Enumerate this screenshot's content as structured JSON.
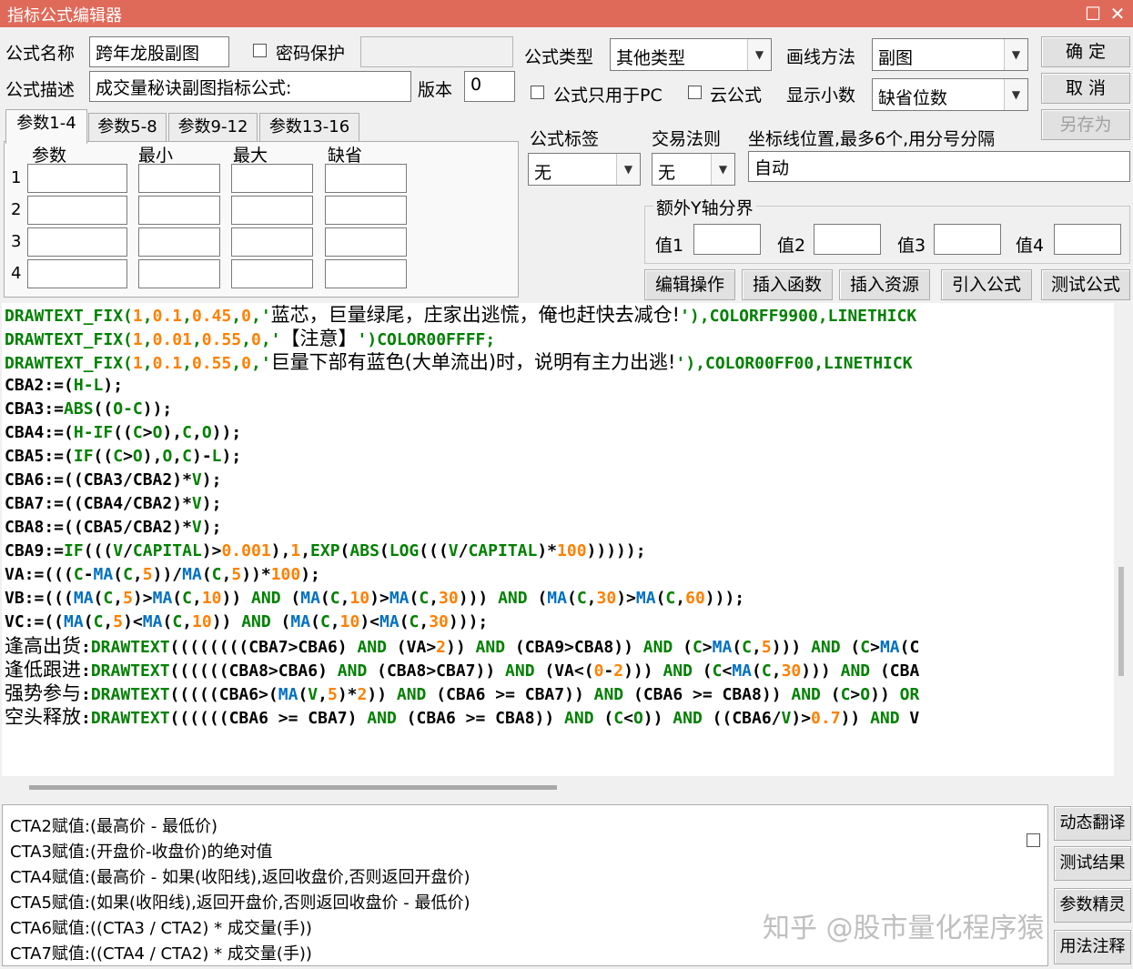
{
  "window": {
    "title": "指标公式编辑器"
  },
  "form": {
    "name_label": "公式名称",
    "name_value": "跨年龙股副图",
    "password_label": "密码保护",
    "desc_label": "公式描述",
    "desc_value": "成交量秘诀副图指标公式:",
    "version_label": "版本",
    "version_value": "0",
    "type_label": "公式类型",
    "type_value": "其他类型",
    "draw_label": "画线方法",
    "draw_value": "副图",
    "pc_only_label": "公式只用于PC",
    "cloud_label": "云公式",
    "decimal_label": "显示小数",
    "decimal_value": "缺省位数",
    "tag_label": "公式标签",
    "tag_value": "无",
    "rule_label": "交易法则",
    "rule_value": "无",
    "coord_label": "坐标线位置,最多6个,用分号分隔",
    "coord_value": "自动",
    "yaxis_label": "额外Y轴分界",
    "v1": "值1",
    "v2": "值2",
    "v3": "值3",
    "v4": "值4"
  },
  "buttons": {
    "ok": "确 定",
    "cancel": "取 消",
    "saveas": "另存为",
    "edit": "编辑操作",
    "insert_func": "插入函数",
    "insert_res": "插入资源",
    "import": "引入公式",
    "test": "测试公式",
    "translate": "动态翻译",
    "result": "测试结果",
    "wizard": "参数精灵",
    "usage": "用法注释"
  },
  "tabs": [
    "参数1-4",
    "参数5-8",
    "参数9-12",
    "参数13-16"
  ],
  "params": {
    "headers": [
      "参数",
      "最小",
      "最大",
      "缺省"
    ],
    "rows": [
      "1",
      "2",
      "3",
      "4"
    ]
  },
  "code_lines": [
    [
      [
        "DRAWTEXT_FIX(",
        "g"
      ],
      [
        "1",
        "o"
      ],
      [
        ",",
        "g"
      ],
      [
        "0.1",
        "o"
      ],
      [
        ",",
        "g"
      ],
      [
        "0.45",
        "o"
      ],
      [
        ",",
        "g"
      ],
      [
        "0",
        "o"
      ],
      [
        ",'",
        "g"
      ],
      [
        "蓝芯，巨量绿尾，庄家出逃慌，俺也赶快去减仓!",
        "zh"
      ],
      [
        "'),COLORFF9900,LINETHICK",
        "g"
      ]
    ],
    [
      [
        "DRAWTEXT_FIX(",
        "g"
      ],
      [
        "1",
        "o"
      ],
      [
        ",",
        "g"
      ],
      [
        "0.01",
        "o"
      ],
      [
        ",",
        "g"
      ],
      [
        "0.55",
        "o"
      ],
      [
        ",",
        "g"
      ],
      [
        "0",
        "o"
      ],
      [
        ",'",
        "g"
      ],
      [
        "【注意】",
        "zh"
      ],
      [
        "')COLOR00FFFF;",
        "g"
      ]
    ],
    [
      [
        "DRAWTEXT_FIX(",
        "g"
      ],
      [
        "1",
        "o"
      ],
      [
        ",",
        "g"
      ],
      [
        "0.1",
        "o"
      ],
      [
        ",",
        "g"
      ],
      [
        "0.55",
        "o"
      ],
      [
        ",",
        "g"
      ],
      [
        "0",
        "o"
      ],
      [
        ",'",
        "g"
      ],
      [
        "巨量下部有蓝色(大单流出)时，说明有主力出逃!",
        "zh"
      ],
      [
        "'),COLOR00FF00,LINETHICK",
        "g"
      ]
    ],
    [
      [
        "CBA2:=(",
        "b"
      ],
      [
        "H-L",
        "g"
      ],
      [
        ");",
        "b"
      ]
    ],
    [
      [
        "CBA3:=",
        "b"
      ],
      [
        "ABS",
        "g"
      ],
      [
        "((",
        "b"
      ],
      [
        "O-C",
        "g"
      ],
      [
        "));",
        "b"
      ]
    ],
    [
      [
        "CBA4:=(",
        "b"
      ],
      [
        "H-IF",
        "g"
      ],
      [
        "((",
        "b"
      ],
      [
        "C",
        "g"
      ],
      [
        ">",
        "b"
      ],
      [
        "O",
        "g"
      ],
      [
        "),",
        "b"
      ],
      [
        "C",
        "g"
      ],
      [
        ",",
        "b"
      ],
      [
        "O",
        "g"
      ],
      [
        "));",
        "b"
      ]
    ],
    [
      [
        "CBA5:=(",
        "b"
      ],
      [
        "IF",
        "g"
      ],
      [
        "((",
        "b"
      ],
      [
        "C",
        "g"
      ],
      [
        ">",
        "b"
      ],
      [
        "O",
        "g"
      ],
      [
        "),",
        "b"
      ],
      [
        "O",
        "g"
      ],
      [
        ",",
        "b"
      ],
      [
        "C",
        "g"
      ],
      [
        ")-",
        "b"
      ],
      [
        "L",
        "g"
      ],
      [
        ");",
        "b"
      ]
    ],
    [
      [
        "CBA6:=((CBA3/CBA2)*",
        "b"
      ],
      [
        "V",
        "g"
      ],
      [
        ");",
        "b"
      ]
    ],
    [
      [
        "CBA7:=((CBA4/CBA2)*",
        "b"
      ],
      [
        "V",
        "g"
      ],
      [
        ");",
        "b"
      ]
    ],
    [
      [
        "CBA8:=((CBA5/CBA2)*",
        "b"
      ],
      [
        "V",
        "g"
      ],
      [
        ");",
        "b"
      ]
    ],
    [
      [
        "CBA9:=",
        "b"
      ],
      [
        "IF",
        "g"
      ],
      [
        "(((",
        "b"
      ],
      [
        "V",
        "g"
      ],
      [
        "/",
        "b"
      ],
      [
        "CAPITAL",
        "g"
      ],
      [
        ")>",
        "b"
      ],
      [
        "0.001",
        "o"
      ],
      [
        "),",
        "b"
      ],
      [
        "1",
        "o"
      ],
      [
        ",",
        "b"
      ],
      [
        "EXP",
        "g"
      ],
      [
        "(",
        "b"
      ],
      [
        "ABS",
        "g"
      ],
      [
        "(",
        "b"
      ],
      [
        "LOG",
        "g"
      ],
      [
        "(((",
        "b"
      ],
      [
        "V",
        "g"
      ],
      [
        "/",
        "b"
      ],
      [
        "CAPITAL",
        "g"
      ],
      [
        ")*",
        "b"
      ],
      [
        "100",
        "o"
      ],
      [
        ")))));",
        "b"
      ]
    ],
    [
      [
        "VA:=(((",
        "b"
      ],
      [
        "C",
        "g"
      ],
      [
        "-",
        "b"
      ],
      [
        "MA",
        "c"
      ],
      [
        "(",
        "b"
      ],
      [
        "C",
        "g"
      ],
      [
        ",",
        "b"
      ],
      [
        "5",
        "o"
      ],
      [
        "))/",
        "b"
      ],
      [
        "MA",
        "c"
      ],
      [
        "(",
        "b"
      ],
      [
        "C",
        "g"
      ],
      [
        ",",
        "b"
      ],
      [
        "5",
        "o"
      ],
      [
        "))*",
        "b"
      ],
      [
        "100",
        "o"
      ],
      [
        ");",
        "b"
      ]
    ],
    [
      [
        "VB:=(((",
        "b"
      ],
      [
        "MA",
        "c"
      ],
      [
        "(",
        "b"
      ],
      [
        "C",
        "g"
      ],
      [
        ",",
        "b"
      ],
      [
        "5",
        "o"
      ],
      [
        ")>",
        "b"
      ],
      [
        "MA",
        "c"
      ],
      [
        "(",
        "b"
      ],
      [
        "C",
        "g"
      ],
      [
        ",",
        "b"
      ],
      [
        "10",
        "o"
      ],
      [
        ")) ",
        "b"
      ],
      [
        "AND",
        "g"
      ],
      [
        " (",
        "b"
      ],
      [
        "MA",
        "c"
      ],
      [
        "(",
        "b"
      ],
      [
        "C",
        "g"
      ],
      [
        ",",
        "b"
      ],
      [
        "10",
        "o"
      ],
      [
        ")>",
        "b"
      ],
      [
        "MA",
        "c"
      ],
      [
        "(",
        "b"
      ],
      [
        "C",
        "g"
      ],
      [
        ",",
        "b"
      ],
      [
        "30",
        "o"
      ],
      [
        "))) ",
        "b"
      ],
      [
        "AND",
        "g"
      ],
      [
        " (",
        "b"
      ],
      [
        "MA",
        "c"
      ],
      [
        "(",
        "b"
      ],
      [
        "C",
        "g"
      ],
      [
        ",",
        "b"
      ],
      [
        "30",
        "o"
      ],
      [
        ")>",
        "b"
      ],
      [
        "MA",
        "c"
      ],
      [
        "(",
        "b"
      ],
      [
        "C",
        "g"
      ],
      [
        ",",
        "b"
      ],
      [
        "60",
        "o"
      ],
      [
        ")));",
        "b"
      ]
    ],
    [
      [
        "VC:=((",
        "b"
      ],
      [
        "MA",
        "c"
      ],
      [
        "(",
        "b"
      ],
      [
        "C",
        "g"
      ],
      [
        ",",
        "b"
      ],
      [
        "5",
        "o"
      ],
      [
        ")<",
        "b"
      ],
      [
        "MA",
        "c"
      ],
      [
        "(",
        "b"
      ],
      [
        "C",
        "g"
      ],
      [
        ",",
        "b"
      ],
      [
        "10",
        "o"
      ],
      [
        ")) ",
        "b"
      ],
      [
        "AND",
        "g"
      ],
      [
        " (",
        "b"
      ],
      [
        "MA",
        "c"
      ],
      [
        "(",
        "b"
      ],
      [
        "C",
        "g"
      ],
      [
        ",",
        "b"
      ],
      [
        "10",
        "o"
      ],
      [
        ")<",
        "b"
      ],
      [
        "MA",
        "c"
      ],
      [
        "(",
        "b"
      ],
      [
        "C",
        "g"
      ],
      [
        ",",
        "b"
      ],
      [
        "30",
        "o"
      ],
      [
        ")));",
        "b"
      ]
    ],
    [
      [
        "逢高出货",
        "zh"
      ],
      [
        ":",
        "b"
      ],
      [
        "DRAWTEXT",
        "g"
      ],
      [
        "((((((((CBA7>CBA6) ",
        "b"
      ],
      [
        "AND",
        "g"
      ],
      [
        " (VA>",
        "b"
      ],
      [
        "2",
        "o"
      ],
      [
        ")) ",
        "b"
      ],
      [
        "AND",
        "g"
      ],
      [
        " (CBA9>CBA8)) ",
        "b"
      ],
      [
        "AND",
        "g"
      ],
      [
        " (",
        "b"
      ],
      [
        "C",
        "g"
      ],
      [
        ">",
        "b"
      ],
      [
        "MA",
        "c"
      ],
      [
        "(",
        "b"
      ],
      [
        "C",
        "g"
      ],
      [
        ",",
        "b"
      ],
      [
        "5",
        "o"
      ],
      [
        "))) ",
        "b"
      ],
      [
        "AND",
        "g"
      ],
      [
        " (",
        "b"
      ],
      [
        "C",
        "g"
      ],
      [
        ">",
        "b"
      ],
      [
        "MA",
        "c"
      ],
      [
        "(C",
        "b"
      ]
    ],
    [
      [
        "逢低跟进",
        "zh"
      ],
      [
        ":",
        "b"
      ],
      [
        "DRAWTEXT",
        "g"
      ],
      [
        "((((((CBA8>CBA6) ",
        "b"
      ],
      [
        "AND",
        "g"
      ],
      [
        " (CBA8>CBA7)) ",
        "b"
      ],
      [
        "AND",
        "g"
      ],
      [
        " (VA<(",
        "b"
      ],
      [
        "0",
        "o"
      ],
      [
        "-",
        "b"
      ],
      [
        "2",
        "o"
      ],
      [
        "))) ",
        "b"
      ],
      [
        "AND",
        "g"
      ],
      [
        " (",
        "b"
      ],
      [
        "C",
        "g"
      ],
      [
        "<",
        "b"
      ],
      [
        "MA",
        "c"
      ],
      [
        "(",
        "b"
      ],
      [
        "C",
        "g"
      ],
      [
        ",",
        "b"
      ],
      [
        "30",
        "o"
      ],
      [
        "))) ",
        "b"
      ],
      [
        "AND",
        "g"
      ],
      [
        " (CBA",
        "b"
      ]
    ],
    [
      [
        "强势参与",
        "zh"
      ],
      [
        ":",
        "b"
      ],
      [
        "DRAWTEXT",
        "g"
      ],
      [
        "(((((CBA6>(",
        "b"
      ],
      [
        "MA",
        "c"
      ],
      [
        "(",
        "b"
      ],
      [
        "V",
        "g"
      ],
      [
        ",",
        "b"
      ],
      [
        "5",
        "o"
      ],
      [
        ")*",
        "b"
      ],
      [
        "2",
        "o"
      ],
      [
        ")) ",
        "b"
      ],
      [
        "AND",
        "g"
      ],
      [
        " (CBA6 >= CBA7)) ",
        "b"
      ],
      [
        "AND",
        "g"
      ],
      [
        " (CBA6 >= CBA8)) ",
        "b"
      ],
      [
        "AND",
        "g"
      ],
      [
        " (",
        "b"
      ],
      [
        "C",
        "g"
      ],
      [
        ">",
        "b"
      ],
      [
        "O",
        "g"
      ],
      [
        ")) ",
        "b"
      ],
      [
        "OR",
        "g"
      ]
    ],
    [
      [
        "空头释放",
        "zh"
      ],
      [
        ":",
        "b"
      ],
      [
        "DRAWTEXT",
        "g"
      ],
      [
        "((((((CBA6 >= CBA7) ",
        "b"
      ],
      [
        "AND",
        "g"
      ],
      [
        " (CBA6 >= CBA8)) ",
        "b"
      ],
      [
        "AND",
        "g"
      ],
      [
        " (",
        "b"
      ],
      [
        "C",
        "g"
      ],
      [
        "<",
        "b"
      ],
      [
        "O",
        "g"
      ],
      [
        ")) ",
        "b"
      ],
      [
        "AND",
        "g"
      ],
      [
        " ((CBA6/",
        "b"
      ],
      [
        "V",
        "g"
      ],
      [
        ")>",
        "b"
      ],
      [
        "0.7",
        "o"
      ],
      [
        ")) ",
        "b"
      ],
      [
        "AND",
        "g"
      ],
      [
        " V",
        "b"
      ]
    ]
  ],
  "explain": [
    "CTA2赋值:(最高价 - 最低价)",
    "CTA3赋值:(开盘价-收盘价)的绝对值",
    "CTA4赋值:(最高价 - 如果(收阳线),返回收盘价,否则返回开盘价)",
    "CTA5赋值:(如果(收阳线),返回开盘价,否则返回收盘价 - 最低价)",
    "CTA6赋值:((CTA3 / CTA2) * 成交量(手))",
    "CTA7赋值:((CTA4 / CTA2) * 成交量(手))"
  ],
  "watermark": "知乎 @股市量化程序猿"
}
